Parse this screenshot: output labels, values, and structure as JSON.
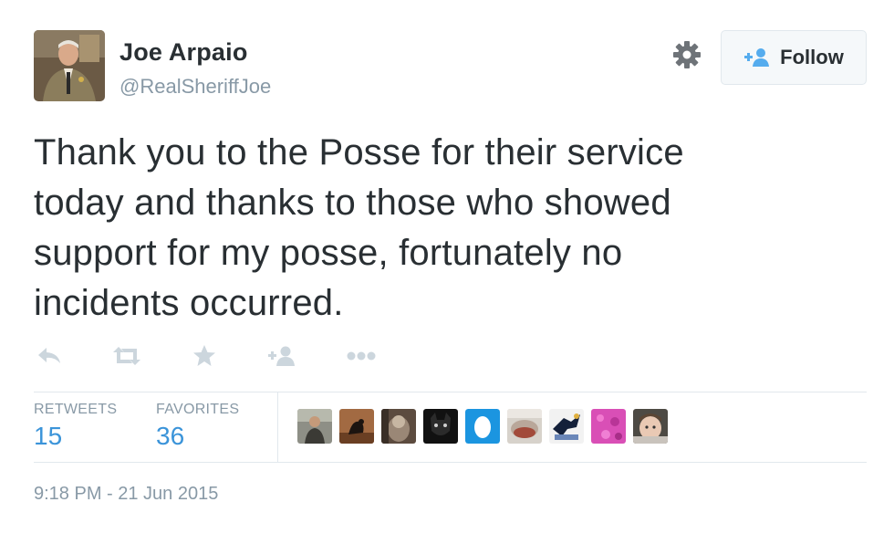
{
  "user": {
    "name": "Joe Arpaio",
    "handle": "@RealSheriffJoe"
  },
  "follow_button": {
    "label": "Follow"
  },
  "tweet": {
    "lines": [
      "Thank you to the Posse for their service",
      "today and thanks to those who showed",
      "support for my posse, fortunately no",
      "incidents occurred."
    ]
  },
  "actions": [
    {
      "icon": "reply-icon"
    },
    {
      "icon": "retweet-icon"
    },
    {
      "icon": "favorite-star-icon"
    },
    {
      "icon": "follow-user-icon"
    },
    {
      "icon": "more-dots-icon"
    }
  ],
  "stats": {
    "retweets_label": "RETWEETS",
    "retweets_value": "15",
    "favorites_label": "FAVORITES",
    "favorites_value": "36"
  },
  "timestamp": "9:18 PM - 21 Jun 2015",
  "colors": {
    "accent": "#3b94d9",
    "muted": "#8899a6",
    "text": "#292f33",
    "border": "#e1e8ed"
  }
}
